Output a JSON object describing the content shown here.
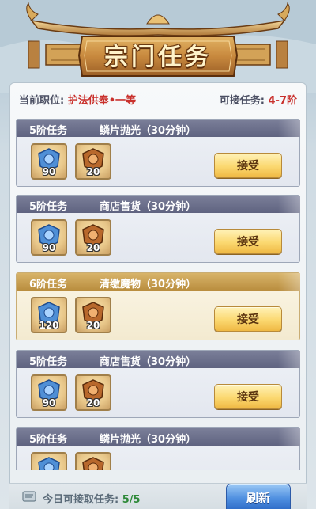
{
  "header": {
    "title": "宗门任务"
  },
  "info": {
    "position_label": "当前职位:",
    "position_value": "护法供奉•一等",
    "tier_label": "可接任务:",
    "tier_value": "4-7阶"
  },
  "tasks": [
    {
      "tier": "5阶任务",
      "name": "鳞片抛光（30分钟）",
      "style": "normal",
      "rewards": [
        {
          "icon": "blue-token-icon",
          "qty": "90"
        },
        {
          "icon": "brown-token-icon",
          "qty": "20"
        }
      ],
      "action": "接受"
    },
    {
      "tier": "5阶任务",
      "name": "商店售货（30分钟）",
      "style": "normal",
      "rewards": [
        {
          "icon": "blue-token-icon",
          "qty": "90"
        },
        {
          "icon": "brown-token-icon",
          "qty": "20"
        }
      ],
      "action": "接受"
    },
    {
      "tier": "6阶任务",
      "name": "清缴魔物（30分钟）",
      "style": "gold",
      "rewards": [
        {
          "icon": "blue-token-icon",
          "qty": "120"
        },
        {
          "icon": "brown-token-icon",
          "qty": "20"
        }
      ],
      "action": "接受"
    },
    {
      "tier": "5阶任务",
      "name": "商店售货（30分钟）",
      "style": "normal",
      "rewards": [
        {
          "icon": "blue-token-icon",
          "qty": "90"
        },
        {
          "icon": "brown-token-icon",
          "qty": "20"
        }
      ],
      "action": "接受"
    },
    {
      "tier": "5阶任务",
      "name": "鳞片抛光（30分钟）",
      "style": "normal",
      "rewards": [
        {
          "icon": "blue-token-icon",
          "qty": ""
        },
        {
          "icon": "brown-token-icon",
          "qty": ""
        }
      ],
      "action": ""
    }
  ],
  "footer": {
    "daily_label": "今日可接取任务:",
    "daily_count": "5/5",
    "refresh_label": "刷新"
  },
  "colors": {
    "accent_red": "#c9302c",
    "count_green": "#2f8a3a",
    "gold_button": "#fbd870",
    "refresh_blue": "#4f8fe0",
    "normal_header": "#6b6f8c",
    "gold_header": "#c9a253"
  }
}
